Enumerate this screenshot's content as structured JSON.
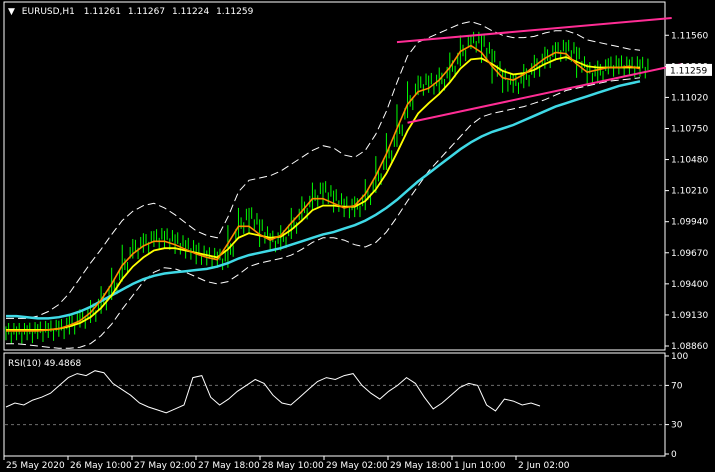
{
  "colors": {
    "background": "#000000",
    "grid": "#6e6e6e",
    "candle": "#00ff00",
    "ema_fast": "#ff8c00",
    "ema_mid": "#ffff00",
    "ema_slow": "#3fd9e6",
    "bands": "#ffffff",
    "trendline": "#ff2d95",
    "rsi": "#ffffff",
    "price_tag_bg": "#ffffff",
    "price_tag_text": "#000000"
  },
  "header": {
    "arrow": "▼",
    "symbol": "EURUSD,H1",
    "open": "1.11261",
    "high": "1.11267",
    "low": "1.11224",
    "close": "1.11259"
  },
  "current_price": "1.11259",
  "rsi_header": "RSI(10) 49.4868",
  "chart_data": [
    {
      "type": "candlestick",
      "title": "EURUSD,H1",
      "y_ticks": [
        "1.11560",
        "1.11290",
        "1.11020",
        "1.10750",
        "1.10480",
        "1.10210",
        "1.09940",
        "1.09670",
        "1.09400",
        "1.09130",
        "1.08860"
      ],
      "x_ticks": [
        "25 May 2020",
        "26 May 10:00",
        "27 May 02:00",
        "27 May 18:00",
        "28 May 10:00",
        "29 May 02:00",
        "29 May 18:00",
        "1 Jun 10:00",
        "2 Jun 02:00"
      ],
      "ylim": [
        1.0886,
        1.1171
      ],
      "series": [
        {
          "name": "price",
          "values": [
            1.0897,
            1.0897,
            1.0898,
            1.0899,
            1.09,
            1.0902,
            1.0908,
            1.0912,
            1.092,
            1.0932,
            1.0948,
            1.0968,
            1.0973,
            1.0978,
            1.098,
            1.0977,
            1.0972,
            1.0968,
            1.0963,
            1.0962,
            1.096,
            1.0985,
            1.1,
            1.099,
            1.0978,
            1.0975,
            1.0985,
            1.1,
            1.101,
            1.1022,
            1.1015,
            1.1008,
            1.1004,
            1.101,
            1.1025,
            1.1045,
            1.1065,
            1.109,
            1.111,
            1.1115,
            1.1112,
            1.1122,
            1.1135,
            1.115,
            1.115,
            1.1138,
            1.112,
            1.1112,
            1.1116,
            1.1125,
            1.1133,
            1.114,
            1.1144,
            1.114,
            1.1125,
            1.112,
            1.1128,
            1.113,
            1.1128,
            1.1129,
            1.1126
          ]
        },
        {
          "name": "ema_fast",
          "values": [
            1.0899,
            1.0899,
            1.0899,
            1.0899,
            1.09,
            1.0901,
            1.0904,
            1.0908,
            1.0915,
            1.0926,
            1.094,
            1.0956,
            1.0966,
            1.0973,
            1.0977,
            1.0977,
            1.0974,
            1.097,
            1.0966,
            1.0963,
            1.0961,
            1.0975,
            1.099,
            1.099,
            1.0983,
            1.0978,
            1.0982,
            1.0993,
            1.1003,
            1.1014,
            1.1014,
            1.101,
            1.1006,
            1.1008,
            1.1018,
            1.1034,
            1.1053,
            1.1075,
            1.1096,
            1.1107,
            1.111,
            1.1117,
            1.1128,
            1.1142,
            1.1147,
            1.1141,
            1.1129,
            1.1119,
            1.1117,
            1.1122,
            1.1129,
            1.1136,
            1.1141,
            1.114,
            1.1131,
            1.1124,
            1.1126,
            1.1128,
            1.1128,
            1.1129,
            1.1127
          ]
        },
        {
          "name": "ema_mid",
          "values": [
            1.09,
            1.09,
            1.09,
            1.09,
            1.09,
            1.0901,
            1.0903,
            1.0906,
            1.0911,
            1.0919,
            1.093,
            1.0944,
            1.0955,
            1.0963,
            1.0969,
            1.0971,
            1.0971,
            1.0969,
            1.0967,
            1.0965,
            1.0963,
            1.097,
            1.098,
            1.0984,
            1.0982,
            1.098,
            1.0981,
            1.0987,
            1.0995,
            1.1004,
            1.1008,
            1.1008,
            1.1007,
            1.1007,
            1.1012,
            1.1022,
            1.1036,
            1.1054,
            1.1073,
            1.1088,
            1.1097,
            1.1105,
            1.1115,
            1.1127,
            1.1135,
            1.1136,
            1.1131,
            1.1125,
            1.1122,
            1.1123,
            1.1126,
            1.1131,
            1.1135,
            1.1137,
            1.1133,
            1.1129,
            1.1128,
            1.1128,
            1.1128,
            1.1128,
            1.1128
          ]
        },
        {
          "name": "ema_slow",
          "values": [
            1.0912,
            1.0912,
            1.0911,
            1.091,
            1.091,
            1.0911,
            1.0913,
            1.0916,
            1.092,
            1.0925,
            1.093,
            1.0935,
            1.094,
            1.0944,
            1.0947,
            1.0949,
            1.095,
            1.0951,
            1.0952,
            1.0953,
            1.0955,
            1.0958,
            1.0962,
            1.0965,
            1.0967,
            1.0969,
            1.0971,
            1.0974,
            1.0977,
            1.098,
            1.0983,
            1.0985,
            1.0988,
            1.0991,
            1.0995,
            1.1,
            1.1006,
            1.1013,
            1.1021,
            1.1029,
            1.1036,
            1.1043,
            1.105,
            1.1057,
            1.1063,
            1.1068,
            1.1072,
            1.1075,
            1.1078,
            1.1082,
            1.1086,
            1.109,
            1.1094,
            1.1097,
            1.11,
            1.1103,
            1.1106,
            1.1109,
            1.1112,
            1.1114,
            1.1116
          ]
        },
        {
          "name": "band_upper",
          "values": [
            1.091,
            1.091,
            1.091,
            1.0912,
            1.0916,
            1.0922,
            1.0932,
            1.0945,
            1.0958,
            1.097,
            1.0983,
            1.0995,
            1.1003,
            1.1008,
            1.101,
            1.1006,
            1.1,
            1.0993,
            1.0986,
            1.0982,
            1.098,
            1.0998,
            1.102,
            1.103,
            1.1032,
            1.1034,
            1.1038,
            1.1044,
            1.105,
            1.1056,
            1.106,
            1.1058,
            1.1052,
            1.105,
            1.1056,
            1.107,
            1.109,
            1.1115,
            1.1138,
            1.115,
            1.1154,
            1.1158,
            1.1162,
            1.1166,
            1.1168,
            1.1165,
            1.116,
            1.1156,
            1.1154,
            1.1154,
            1.1155,
            1.1158,
            1.116,
            1.116,
            1.1157,
            1.1152,
            1.115,
            1.1148,
            1.1146,
            1.1144,
            1.1143
          ]
        },
        {
          "name": "band_lower",
          "values": [
            1.0888,
            1.0888,
            1.0887,
            1.0886,
            1.0885,
            1.0884,
            1.0884,
            1.0885,
            1.0888,
            1.0895,
            1.0905,
            1.0918,
            1.093,
            1.0942,
            1.095,
            1.0954,
            1.0953,
            1.095,
            1.0946,
            1.0942,
            1.094,
            1.0942,
            1.0948,
            1.0955,
            1.0958,
            1.096,
            1.0962,
            1.0965,
            1.097,
            1.0976,
            1.098,
            1.098,
            1.0978,
            1.0974,
            1.0972,
            1.0976,
            1.0985,
            1.0998,
            1.1012,
            1.1025,
            1.1038,
            1.1048,
            1.1058,
            1.1068,
            1.1078,
            1.1085,
            1.1088,
            1.109,
            1.1092,
            1.1094,
            1.1097,
            1.11,
            1.1104,
            1.1108,
            1.111,
            1.1112,
            1.1114,
            1.1116,
            1.1117,
            1.1118,
            1.1119
          ]
        }
      ],
      "trendlines": [
        {
          "from": [
            37,
            1.115
          ],
          "to": [
            63,
            1.1171
          ]
        },
        {
          "from": [
            38,
            1.108
          ],
          "to": [
            64,
            1.1131
          ]
        }
      ]
    },
    {
      "type": "line",
      "title": "RSI(10) 49.4868",
      "y_ticks": [
        "100",
        "70",
        "30",
        "0"
      ],
      "ylim": [
        0,
        100
      ],
      "levels": [
        70,
        30
      ],
      "series": [
        {
          "name": "RSI(10)",
          "values": [
            48,
            52,
            50,
            55,
            58,
            62,
            70,
            78,
            82,
            80,
            85,
            83,
            72,
            66,
            60,
            52,
            48,
            45,
            42,
            46,
            50,
            78,
            80,
            58,
            50,
            56,
            64,
            70,
            76,
            72,
            60,
            52,
            50,
            58,
            66,
            74,
            78,
            76,
            80,
            82,
            70,
            62,
            56,
            64,
            70,
            78,
            72,
            58,
            46,
            52,
            60,
            68,
            72,
            70,
            50,
            44,
            56,
            54,
            50,
            52,
            49
          ]
        }
      ]
    }
  ]
}
